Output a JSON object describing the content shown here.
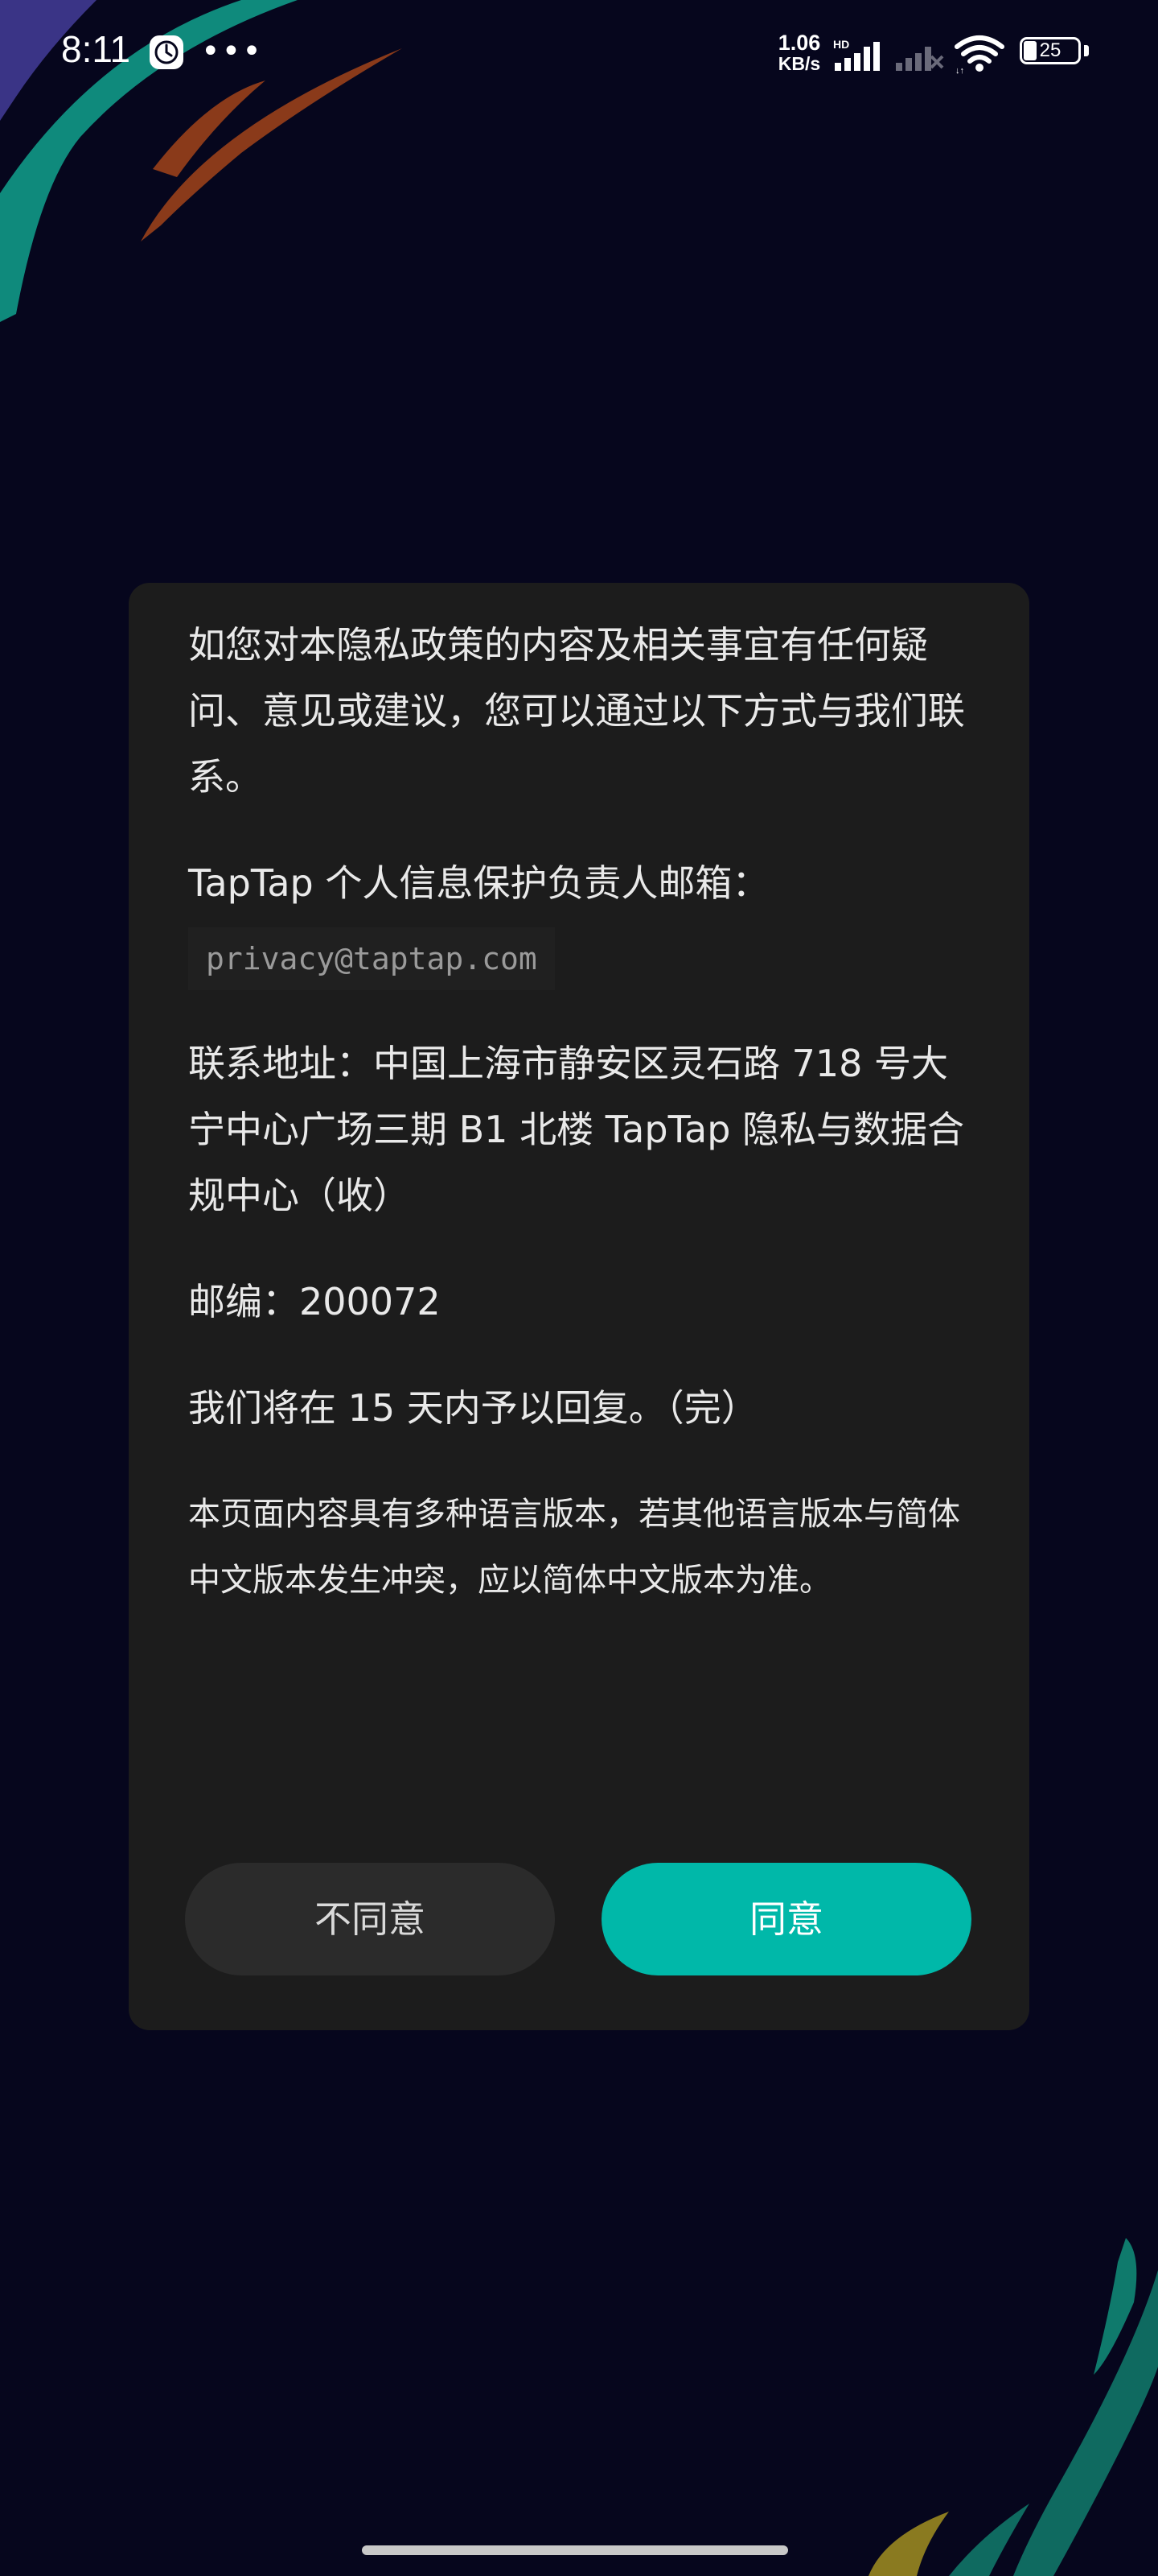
{
  "status_bar": {
    "time": "8:11",
    "net_speed_value": "1.06",
    "net_speed_unit": "KB/s",
    "hd_label": "HD",
    "battery_level": "25",
    "icons": [
      "clock-icon",
      "more-icon",
      "signal-icon",
      "signal-icon",
      "wifi-icon",
      "battery-icon"
    ]
  },
  "dialog": {
    "intro": "如您对本隐私政策的内容及相关事宜有任何疑问、意见或建议，您可以通过以下方式与我们联系。",
    "email_label": "TapTap 个人信息保护负责人邮箱：",
    "email": "privacy@taptap.com",
    "address": "联系地址：中国上海市静安区灵石路 718 号大宁中心广场三期 B1 北楼 TapTap 隐私与数据合规中心（收）",
    "postcode": "邮编：200072",
    "reply": "我们将在 15 天内予以回复。（完）",
    "language_note": "本页面内容具有多种语言版本，若其他语言版本与简体中文版本发生冲突，应以简体中文版本为准。",
    "disagree_label": "不同意",
    "agree_label": "同意"
  },
  "colors": {
    "background": "#06061d",
    "dialog": "#1c1c1c",
    "accent": "#00b8a9"
  }
}
